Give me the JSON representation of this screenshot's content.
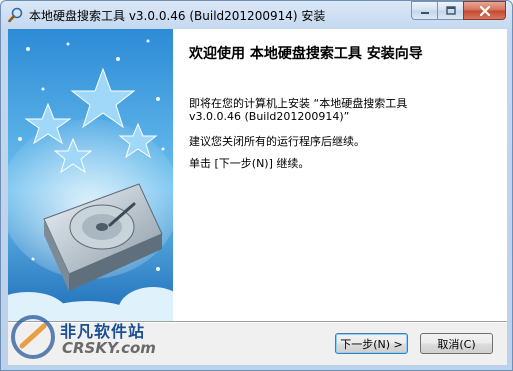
{
  "window": {
    "title": "本地硬盘搜索工具 v3.0.0.46 (Build201200914) 安装"
  },
  "welcome": {
    "heading": "欢迎使用 本地硬盘搜索工具 安装向导",
    "line1": "即将在您的计算机上安装 “本地硬盘搜索工具\nv3.0.0.46 (Build201200914)”",
    "line2": "建议您关闭所有的运行程序后继续。",
    "line3": "单击 [下一步(N)] 继续。"
  },
  "buttons": {
    "next": "下一步(N) >",
    "cancel": "取消(C)"
  },
  "watermark": {
    "name_cn": "非凡软件站",
    "name_en": "CRSKY.com"
  },
  "colors": {
    "banner_sky": "#4aa3e0",
    "title_bar": "#c3d7ee",
    "accent_blue": "#1a4f94"
  },
  "icons": {
    "app": "magnifier-icon",
    "minimize": "minimize-icon",
    "maximize": "maximize-icon",
    "close": "close-icon",
    "banner": "hard-drive-illustration"
  }
}
